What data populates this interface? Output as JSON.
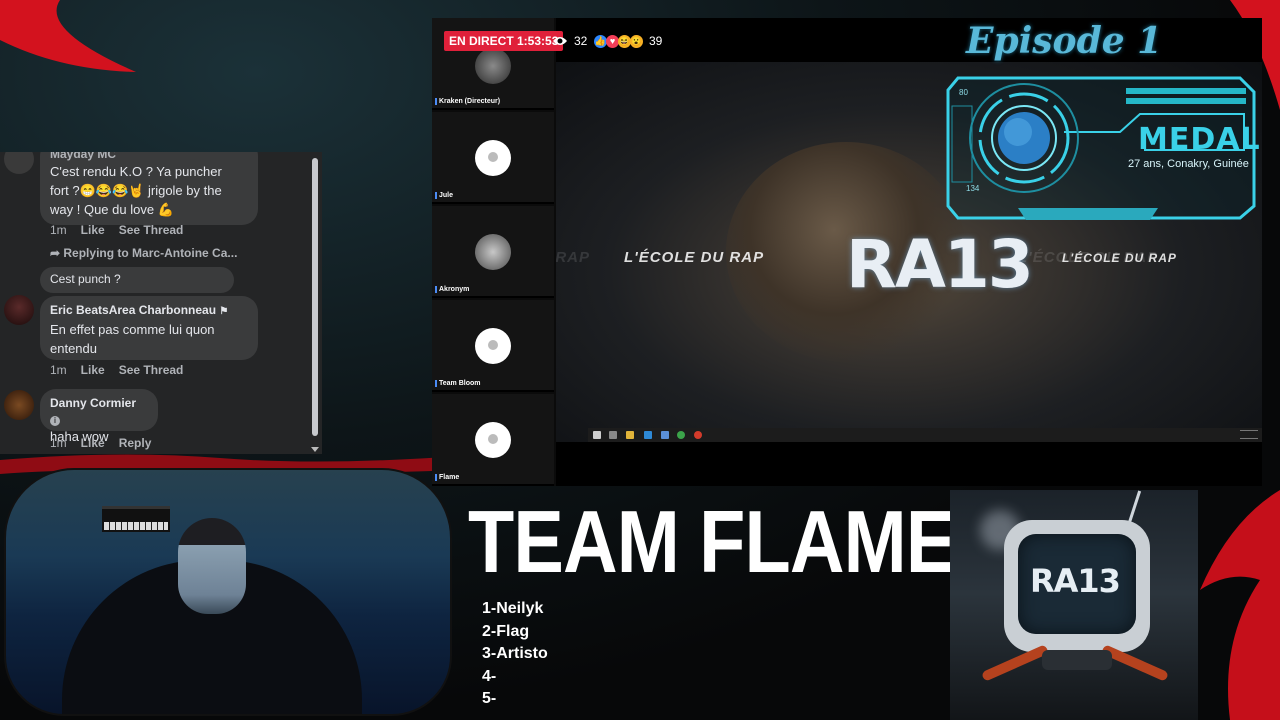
{
  "stream": {
    "live_label": "EN DIRECT 1:53:53",
    "viewer_count": "32",
    "reaction_count": "39",
    "reactions": [
      "like-icon",
      "love-icon",
      "haha-icon",
      "wow-icon"
    ]
  },
  "participants": [
    {
      "name": "Kraken (Directeur)",
      "has_photo": true
    },
    {
      "name": "Jule",
      "has_photo": false
    },
    {
      "name": "Akronym",
      "has_photo": true
    },
    {
      "name": "Team Bloom",
      "has_photo": false
    },
    {
      "name": "Flame",
      "has_photo": false
    }
  ],
  "shared_screen": {
    "tagline": "L'ÉCOLE DU RAP",
    "logo": "RA13"
  },
  "hud": {
    "episode": "Episode 1",
    "name": "MEDAL",
    "details": "27 ans, Conakry, Guinée",
    "dial_top": "80",
    "dial_bottom": "134"
  },
  "chat": {
    "messages": [
      {
        "author": "Mayday MC",
        "text_lines": [
          "C'est rendu K.O ? Ya puncher",
          "fort ?😁😂😂🤘 jrigole by the",
          "way ! Que du love 💪"
        ],
        "actions": [
          "1m",
          "Like",
          "See Thread"
        ]
      },
      {
        "reply_ref": "Replying to Marc-Antoine Ca...",
        "text_lines": [
          "Cest punch ?"
        ]
      },
      {
        "author": "Eric BeatsArea Charbonneau",
        "text_lines": [
          "En effet pas comme lui quon",
          "entendu"
        ],
        "actions": [
          "1m",
          "Like",
          "See Thread"
        ]
      },
      {
        "author": "Danny Cormier",
        "text_lines": [
          "haha wow"
        ],
        "actions": [
          "1m",
          "Like",
          "Reply"
        ]
      }
    ]
  },
  "team": {
    "title": "TEAM FLAME",
    "roster": [
      "1-Neilyk",
      "2-Flag",
      "3-Artisto",
      "4-",
      "5-"
    ]
  },
  "robot_logo": "RA13",
  "colors": {
    "live_red": "#e0203a",
    "hud_cyan": "#3ad1e8",
    "chat_bg": "#242526",
    "bubble_bg": "#3a3b3c",
    "accent_red": "#d3121e"
  }
}
